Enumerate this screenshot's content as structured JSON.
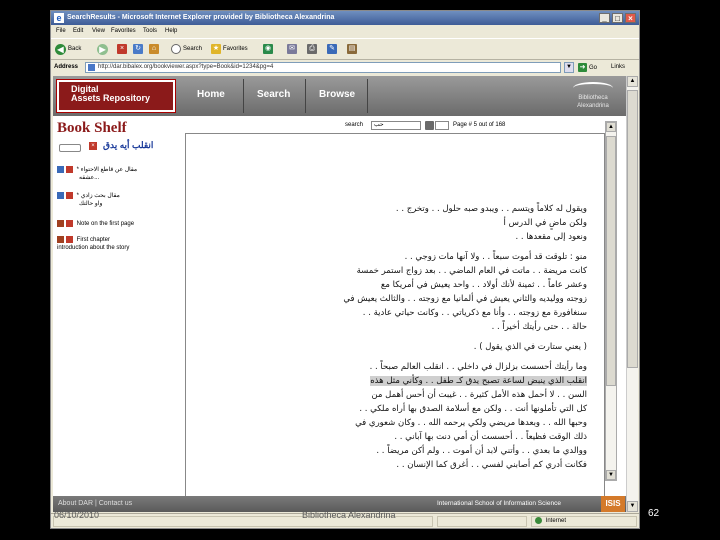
{
  "window": {
    "title": "SearchResults - Microsoft Internet Explorer provided by Bibliotheca Alexandrina",
    "ie_icon": "e",
    "min": "_",
    "max": "□",
    "close": "×"
  },
  "menu": [
    "File",
    "Edit",
    "View",
    "Favorites",
    "Tools",
    "Help"
  ],
  "toolbar": {
    "back_label": "Back",
    "back_glyph": "◀",
    "fwd_glyph": "▶",
    "stop_glyph": "×",
    "refresh_glyph": "↻",
    "home_glyph": "⌂",
    "search_label": "Search",
    "favorites_label": "Favorites",
    "favorites_glyph": "★",
    "media_glyph": "◉",
    "mail_glyph": "✉",
    "print_glyph": "⎙",
    "edit_glyph": "✎",
    "discuss_glyph": "▤"
  },
  "address": {
    "label": "Address",
    "value": "http://dar.bibalex.org/bookviewer.aspx?type=Book&id=1234&pg=4",
    "dropdown": "▼",
    "go_label": "Go",
    "go_glyph": "➜",
    "links_label": "Links"
  },
  "site": {
    "logo_line1": "Digital",
    "logo_line2": "Assets Repository",
    "nav": [
      "Home",
      "Search",
      "Browse"
    ],
    "right_logo_text": "Bibliotheca Alexandrina"
  },
  "sidebar": {
    "title": "Book Shelf",
    "book_title": "انقلب أيه يدق",
    "items": [
      {
        "label": "* مقال عن قاطع الاحتواء",
        "sub": "عشقه..."
      },
      {
        "label": "* مقال بحث زادي",
        "sub": "واو حالتك"
      },
      {
        "label": "Note on the first page",
        "sub": ""
      },
      {
        "label": "First chapter",
        "sub": "introduction about the story"
      }
    ]
  },
  "viewer": {
    "search_label": "search",
    "search_value": "حب",
    "page_label": "Page # 5 out of 168"
  },
  "page_lines": [
    "ويقول له كلاماً ويتسم . . ويبدو صبه حلول . . وتخرج . .",
    "ولكن ماضٍ في الدرس أ",
    "ونعود إلى مقعدها . .",
    "منو : تلوقت قد أموت سبعاً . . ولا آنها مات زوجي . .",
    "كانت مريضة . . ماتت في العام الماضي . . بعد زواج استمر خمسة",
    "وعشر عاماً . . ثمينة لأنك أولاد . . واحد يعيش في أمريكا مع",
    "زوجته ووليديه والثاني يعيش في ألمانيا مع زوجته . . والثالث يعيش في",
    "سنغافورة مع زوجته . . وأنا مع ذكرياتي . . وكانت حياتي عادية . .",
    "حالة . . حتى رأيتك أخيراً . .",
    "( يعني ستارت في الذي يقول ) .",
    "وما رأيتك أحسست بزلزال في داخلي . . انقلب العالم صبحاً . .",
    "انقلب الذي ينبض لساعة تصبح يدق كـ طفل . . وكأني مثل هذه",
    "السن . . لا أحمل هذه الأمل كثيرة . . غيبت أن أحس أهمل من",
    "كل التي تأملونها أنت . . ولكن مع أسلامة الصدق بها أراه ملكي . .",
    "وحبها الله . . وبعدها مريضي ولكي يرحمه الله . . وكان شعوري في",
    "ذلك الوقت فظيعاً . . أحسست أن أمي دنت بها آباني . .",
    "ووالدي ما بعدي . . وأتني لابد أن أموت . . ولم أكن مريضاً . .",
    "فكانت أدري كم أصابني لفسي . . أغرق كما الإنسان . ."
  ],
  "footer": {
    "link": "About DAR | Contact us",
    "right": "International School of Information Science",
    "badge": "ISIS"
  },
  "status": {
    "done": "",
    "zone": "Internet"
  },
  "slide": {
    "date": "06/10/2010",
    "org": "Bibliotheca Alexandrina",
    "number": "62"
  }
}
